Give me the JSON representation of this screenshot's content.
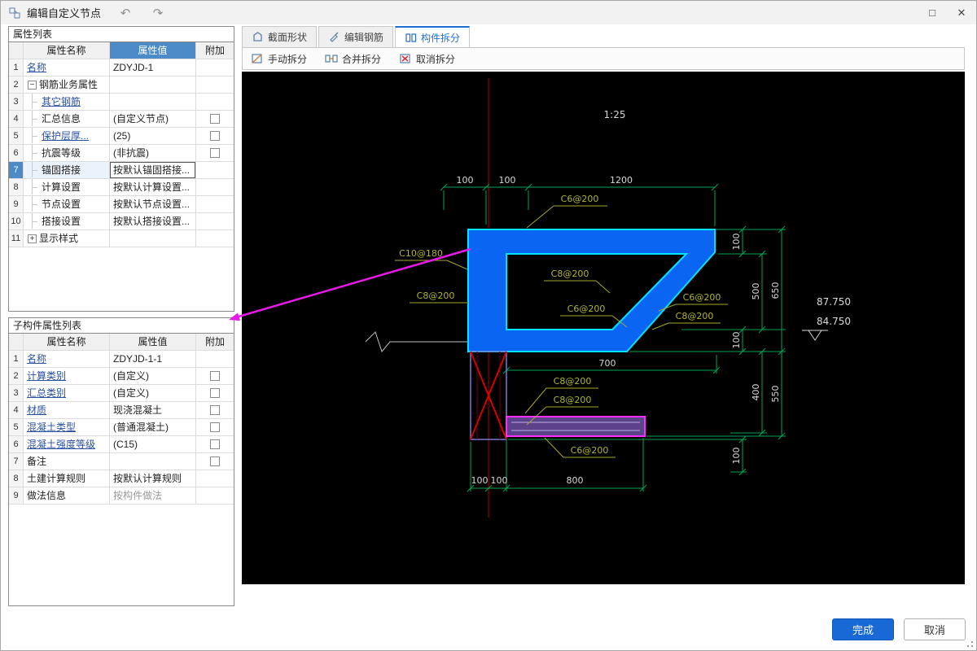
{
  "window": {
    "title": "编辑自定义节点",
    "undo_icon": "↶",
    "redo_icon": "↷",
    "maximize_icon": "□",
    "close_icon": "✕"
  },
  "left": {
    "property_list_title": "属性列表",
    "sub_property_list_title": "子构件属性列表",
    "columns": {
      "name": "属性名称",
      "value": "属性值",
      "extra": "附加"
    },
    "property_rows": [
      {
        "num": "1",
        "name": "名称",
        "value": "ZDYJD-1"
      },
      {
        "num": "2",
        "name": "钢筋业务属性",
        "value": "",
        "expander": "−"
      },
      {
        "num": "3",
        "name": "其它钢筋",
        "value": ""
      },
      {
        "num": "4",
        "name": "汇总信息",
        "value": "(自定义节点)"
      },
      {
        "num": "5",
        "name": "保护层厚...",
        "value": "(25)"
      },
      {
        "num": "6",
        "name": "抗震等级",
        "value": "(非抗震)"
      },
      {
        "num": "7",
        "name": "锚固搭接",
        "value": "按默认锚固搭接..."
      },
      {
        "num": "8",
        "name": "计算设置",
        "value": "按默认计算设置..."
      },
      {
        "num": "9",
        "name": "节点设置",
        "value": "按默认节点设置..."
      },
      {
        "num": "10",
        "name": "搭接设置",
        "value": "按默认搭接设置..."
      },
      {
        "num": "11",
        "name": "显示样式",
        "value": "",
        "expander": "+"
      }
    ],
    "sub_rows": [
      {
        "num": "1",
        "name": "名称",
        "value": "ZDYJD-1-1"
      },
      {
        "num": "2",
        "name": "计算类别",
        "value": "(自定义)"
      },
      {
        "num": "3",
        "name": "汇总类别",
        "value": "(自定义)"
      },
      {
        "num": "4",
        "name": "材质",
        "value": "现浇混凝土"
      },
      {
        "num": "5",
        "name": "混凝土类型",
        "value": "(普通混凝土)"
      },
      {
        "num": "6",
        "name": "混凝土强度等级",
        "value": "(C15)"
      },
      {
        "num": "7",
        "name": "备注",
        "value": ""
      },
      {
        "num": "8",
        "name": "土建计算规则",
        "value": "按默认计算规则"
      },
      {
        "num": "9",
        "name": "做法信息",
        "value": "按构件做法"
      }
    ]
  },
  "tabs": [
    {
      "label": "截面形状"
    },
    {
      "label": "编辑钢筋"
    },
    {
      "label": "构件拆分"
    }
  ],
  "toolbar": [
    {
      "label": "手动拆分"
    },
    {
      "label": "合并拆分"
    },
    {
      "label": "取消拆分"
    }
  ],
  "drawing": {
    "scale": "1:25",
    "top_dims": [
      "100",
      "100",
      "1200"
    ],
    "right_dims": [
      "100",
      "500",
      "100",
      "650",
      "400",
      "550",
      "100"
    ],
    "elevations": [
      "87.750",
      "84.750"
    ],
    "dim_700": "700",
    "bottom_dims": [
      "100",
      "100",
      "800"
    ],
    "rebar_labels": [
      "C6@200",
      "C10@180",
      "C8@200",
      "C8@200",
      "C6@200",
      "C6@200",
      "C8@200",
      "C8@200",
      "C8@200",
      "C6@200"
    ]
  },
  "footer": {
    "finish": "完成",
    "cancel": "取消"
  }
}
